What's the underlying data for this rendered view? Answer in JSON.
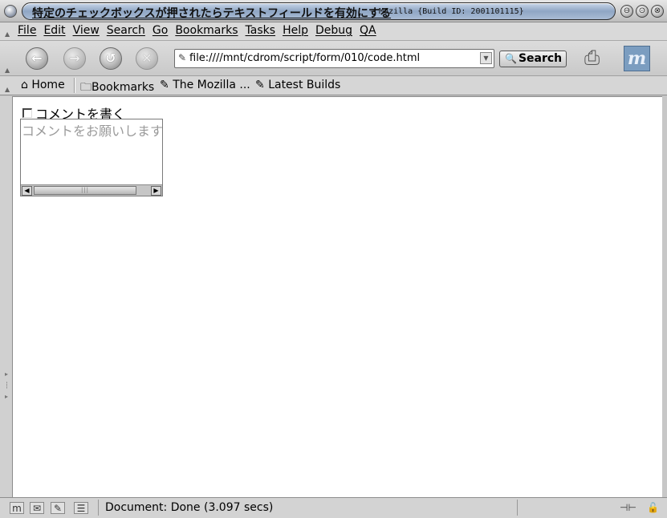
{
  "window": {
    "title": "特定のチェックボックスが押されたらテキストフィールドを有効にする",
    "subtitle": "- Mozilla {Build ID: 2001101115}",
    "buttons": {
      "minimize": "⊖",
      "maximize": "⊙",
      "close": "⊗"
    }
  },
  "menu": {
    "items": [
      "File",
      "Edit",
      "View",
      "Search",
      "Go",
      "Bookmarks",
      "Tasks",
      "Help",
      "Debug",
      "QA"
    ]
  },
  "navigation": {
    "back_icon": "back-arrow-icon",
    "forward_icon": "forward-arrow-icon",
    "reload_icon": "reload-icon",
    "stop_icon": "stop-icon",
    "url": "file:////mnt/cdrom/script/form/010/code.html",
    "search_label": "Search"
  },
  "personal_toolbar": {
    "home": "Home",
    "bookmarks": "Bookmarks",
    "link1": "The Mozilla ...",
    "link2": "Latest Builds"
  },
  "content": {
    "checkbox_label": "コメントを書く",
    "checkbox_checked": false,
    "textarea_placeholder": "コメントをお願いします"
  },
  "status": {
    "text": "Document: Done (3.097 secs)"
  }
}
